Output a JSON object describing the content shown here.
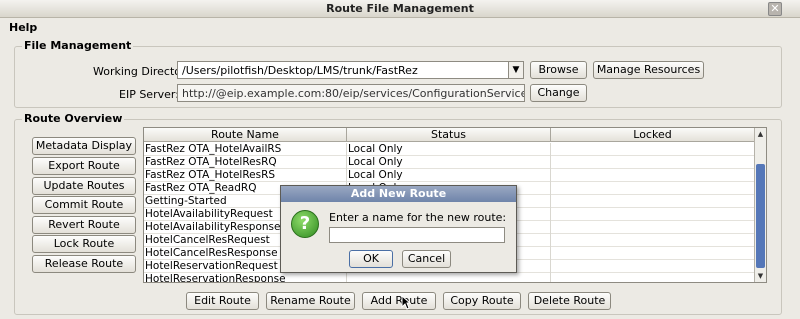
{
  "window": {
    "title": "Route File Management",
    "close_glyph": "✕"
  },
  "menu": {
    "help": "Help"
  },
  "file_management": {
    "group_title": "File Management",
    "working_dir_label": "Working Directory:",
    "working_dir_value": "/Users/pilotfish/Desktop/LMS/trunk/FastRez",
    "browse": "Browse",
    "manage_resources": "Manage Resources",
    "eip_label": "EIP Server:",
    "eip_value": "http://@eip.example.com:80/eip/services/ConfigurationService",
    "change": "Change"
  },
  "route_overview": {
    "group_title": "Route Overview",
    "side_buttons": [
      "Metadata Display",
      "Export Route",
      "Update Routes",
      "Commit Route",
      "Revert Route",
      "Lock Route",
      "Release Route"
    ],
    "columns": [
      "Route Name",
      "Status",
      "Locked"
    ],
    "rows": [
      {
        "name": "FastRez OTA_HotelAvailRS",
        "status": "Local Only",
        "locked": ""
      },
      {
        "name": "FastRez OTA_HotelResRQ",
        "status": "Local Only",
        "locked": ""
      },
      {
        "name": "FastRez OTA_HotelResRS",
        "status": "Local Only",
        "locked": ""
      },
      {
        "name": "FastRez OTA_ReadRQ",
        "status": "Local Only",
        "locked": ""
      },
      {
        "name": "Getting-Started",
        "status": "",
        "locked": ""
      },
      {
        "name": "HotelAvailabilityRequest",
        "status": "",
        "locked": ""
      },
      {
        "name": "HotelAvailabilityResponse",
        "status": "",
        "locked": ""
      },
      {
        "name": "HotelCancelResRequest",
        "status": "",
        "locked": ""
      },
      {
        "name": "HotelCancelResResponse",
        "status": "",
        "locked": ""
      },
      {
        "name": "HotelReservationRequest",
        "status": "",
        "locked": ""
      },
      {
        "name": "HotelReservationResponse",
        "status": "",
        "locked": ""
      }
    ],
    "bottom_buttons": [
      "Edit Route",
      "Rename Route",
      "Add Route",
      "Copy Route",
      "Delete Route"
    ]
  },
  "dialog": {
    "title": "Add New Route",
    "prompt": "Enter a name for the new route:",
    "input_value": "",
    "ok": "OK",
    "cancel": "Cancel",
    "icon": "question-icon",
    "icon_glyph": "?"
  },
  "scrollbar": {
    "up_glyph": "▲",
    "down_glyph": "▼"
  },
  "colors": {
    "dialog_title": "#7b8eb1",
    "scroll_thumb": "#5577b8",
    "icon_green": "#3a9a28"
  }
}
